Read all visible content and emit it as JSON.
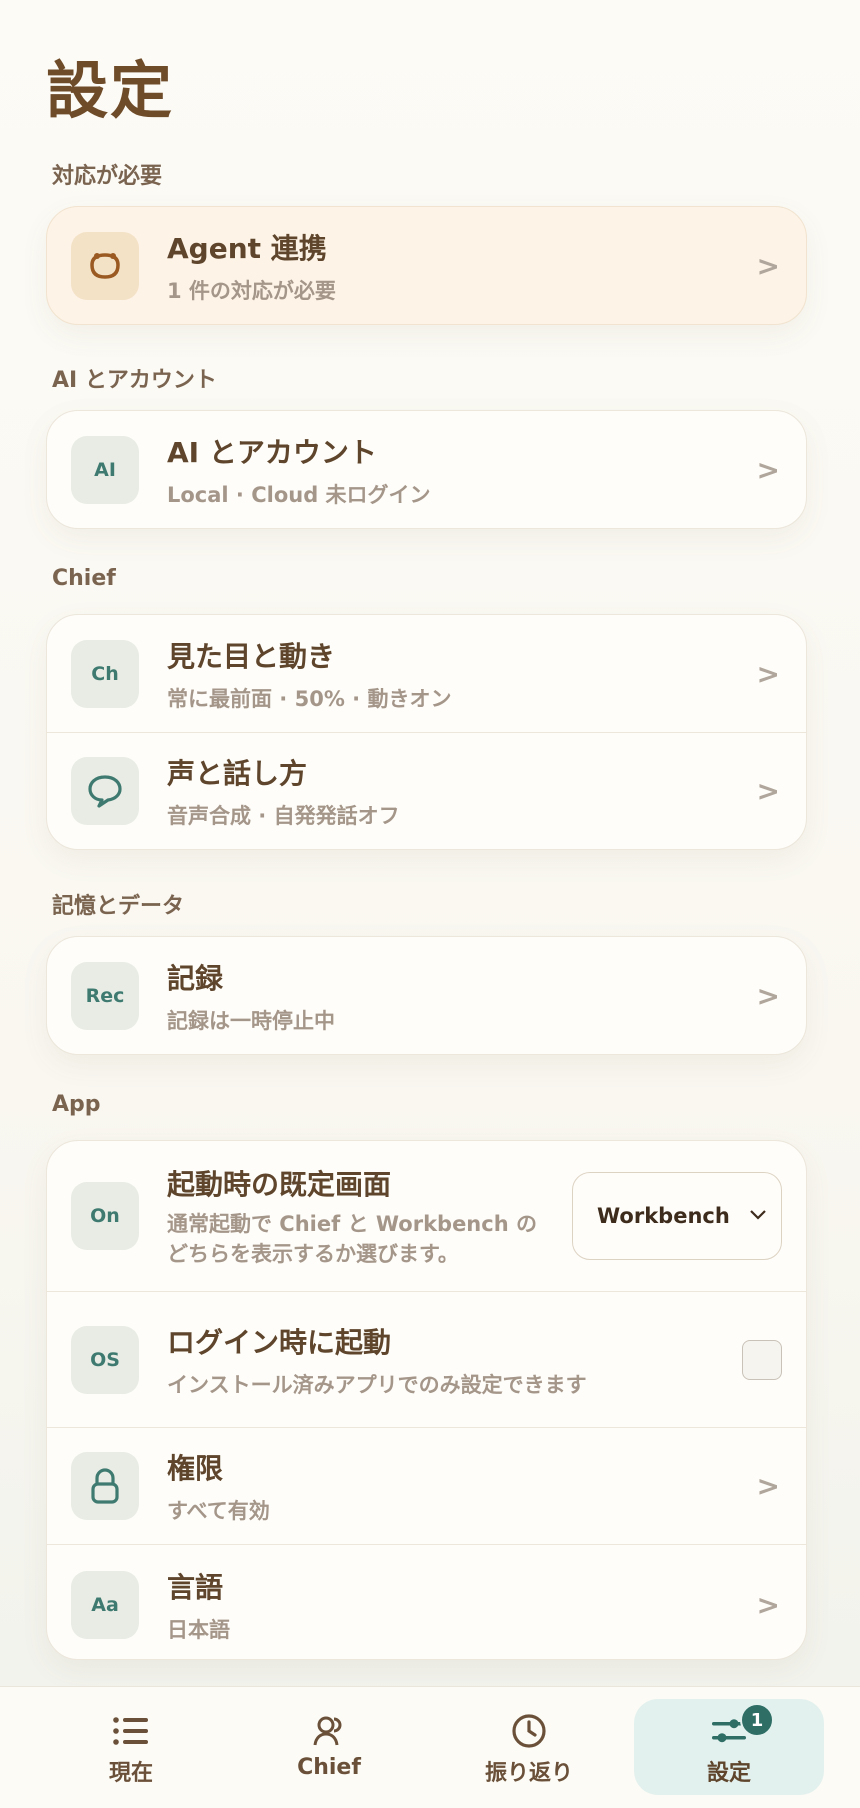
{
  "page": {
    "title": "設定"
  },
  "sections": {
    "needs_action": {
      "label": "対応が必要",
      "rows": [
        {
          "icon": "agent-icon",
          "title": "Agent 連携",
          "subtitle": "1 件の対応が必要",
          "chevron": ">"
        }
      ]
    },
    "ai_account": {
      "label": "AI とアカウント",
      "rows": [
        {
          "icon_text": "AI",
          "title": "AI とアカウント",
          "subtitle": "Local · Cloud 未ログイン",
          "chevron": ">"
        }
      ]
    },
    "chief": {
      "label": "Chief",
      "rows": [
        {
          "icon_text": "Ch",
          "title": "見た目と動き",
          "subtitle": "常に最前面 · 50% · 動きオン",
          "chevron": ">"
        },
        {
          "icon": "speech-bubble-icon",
          "title": "声と話し方",
          "subtitle": "音声合成 · 自発発話オフ",
          "chevron": ">"
        }
      ]
    },
    "memory": {
      "label": "記憶とデータ",
      "rows": [
        {
          "icon_text": "Rec",
          "title": "記録",
          "subtitle": "記録は一時停止中",
          "chevron": ">"
        }
      ]
    },
    "app": {
      "label": "App",
      "rows": [
        {
          "icon_text": "On",
          "title": "起動時の既定画面",
          "subtitle": "通常起動で Chief と Workbench のどちらを表示するか選びます。",
          "select_value": "Workbench"
        },
        {
          "icon_text": "OS",
          "title": "ログイン時に起動",
          "subtitle": "インストール済みアプリでのみ設定できます",
          "checked": false
        },
        {
          "icon": "lock-icon",
          "title": "権限",
          "subtitle": "すべて有効",
          "chevron": ">"
        },
        {
          "icon_text": "Aa",
          "title": "言語",
          "subtitle": "日本語",
          "chevron": ">"
        }
      ]
    }
  },
  "tabbar": {
    "items": [
      {
        "label": "現在",
        "icon": "list-icon"
      },
      {
        "label": "Chief",
        "icon": "people-icon"
      },
      {
        "label": "振り返り",
        "icon": "clock-icon"
      },
      {
        "label": "設定",
        "icon": "sliders-icon",
        "badge": "1",
        "active": true
      }
    ]
  },
  "colors": {
    "accent": "#2e6e65",
    "title": "#6f4c29",
    "alert_bg": "#fdf3e6"
  }
}
